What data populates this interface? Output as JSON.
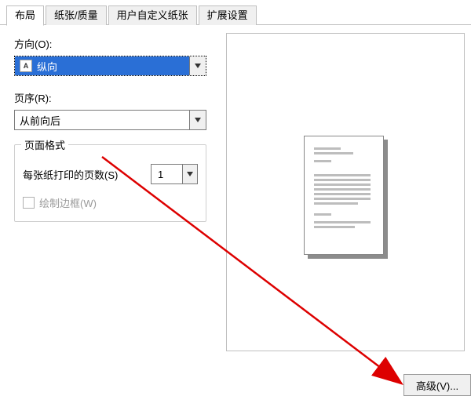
{
  "tabs": {
    "layout": "布局",
    "paper_quality": "纸张/质量",
    "custom_paper": "用户自定义纸张",
    "extended": "扩展设置"
  },
  "orientation": {
    "label": "方向(O):",
    "value": "纵向",
    "icon_letter": "A"
  },
  "page_order": {
    "label": "页序(R):",
    "value": "从前向后"
  },
  "page_format": {
    "title": "页面格式",
    "pages_per_sheet_label": "每张纸打印的页数(S)",
    "pages_per_sheet_value": "1",
    "draw_border_label": "绘制边框(W)"
  },
  "buttons": {
    "advanced": "高级(V)..."
  }
}
